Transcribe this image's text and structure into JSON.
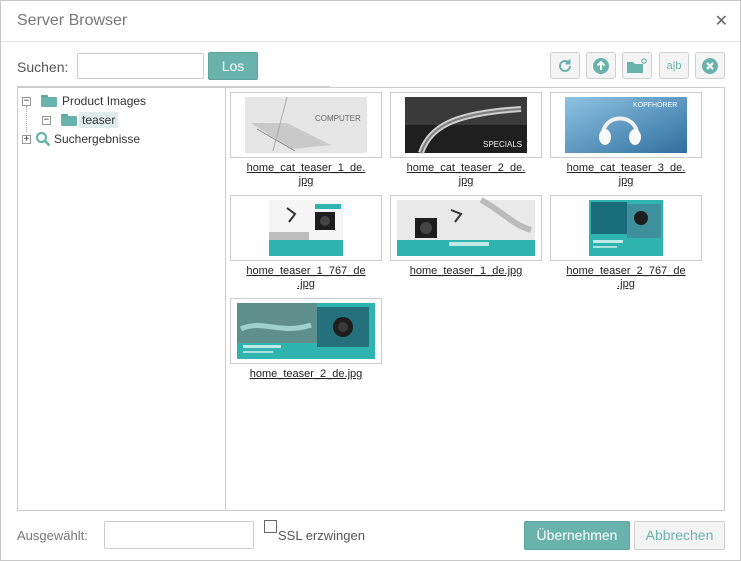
{
  "dialog": {
    "title": "Server Browser",
    "close_icon": "close-icon"
  },
  "search": {
    "label": "Suchen:",
    "value": "",
    "go_label": "Los"
  },
  "toolbar": {
    "buttons": [
      {
        "name": "refresh-icon"
      },
      {
        "name": "upload-icon"
      },
      {
        "name": "new-folder-icon"
      },
      {
        "name": "rename-icon",
        "glyph": "a|b"
      },
      {
        "name": "delete-icon"
      }
    ]
  },
  "tree": {
    "root": {
      "label": "Product Images",
      "expander": "−"
    },
    "child": {
      "label": "teaser",
      "expander": "−"
    },
    "search_results": {
      "label": "Suchergebnisse",
      "expander": "+"
    }
  },
  "files": [
    {
      "line1": "home_cat_teaser_1_de.",
      "line2": "jpg",
      "overlay": "COMPUTER"
    },
    {
      "line1": "home_cat_teaser_2_de.",
      "line2": "jpg",
      "overlay": "SPECIALS"
    },
    {
      "line1": "home_cat_teaser_3_de.",
      "line2": "jpg",
      "overlay": "KOPFHÖRER"
    },
    {
      "line1": "home_teaser_1_767_de",
      "line2": ".jpg",
      "overlay": ""
    },
    {
      "line1": "home_teaser_1_de.jpg",
      "line2": "",
      "overlay": ""
    },
    {
      "line1": "home_teaser_2_767_de",
      "line2": ".jpg",
      "overlay": ""
    },
    {
      "line1": "home_teaser_2_de.jpg",
      "line2": "",
      "overlay": ""
    }
  ],
  "footer": {
    "selected_label": "Ausgewählt:",
    "selected_value": "",
    "ssl_label": "SSL erzwingen",
    "ssl_checked": false,
    "apply_label": "Übernehmen",
    "cancel_label": "Abbrechen"
  },
  "colors": {
    "accent": "#6ab3ad",
    "teal_image": "#2fb4b0"
  }
}
